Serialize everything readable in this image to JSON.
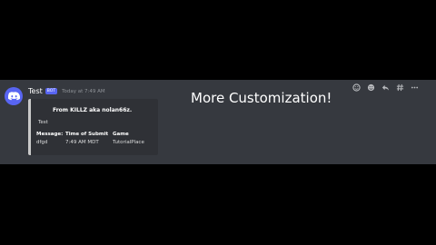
{
  "message": {
    "username": "Test",
    "bot_tag": "BOT",
    "timestamp": "Today at 7:49 AM"
  },
  "embed": {
    "author": "From KILLZ aka nolan66z.",
    "description": "Test",
    "fields": [
      {
        "name": "Message:",
        "value": "dfgd"
      },
      {
        "name": "Time of Submit",
        "value": "7:49 AM MDT"
      },
      {
        "name": "Game",
        "value": "TutorialPlace"
      }
    ],
    "accent_color": "#c9c9c9"
  },
  "overlay_title": "More Customization!",
  "toolbar_icons": [
    "add-reaction-icon",
    "emoji-icon",
    "reply-icon",
    "thread-icon",
    "more-icon"
  ],
  "colors": {
    "background": "#36393f",
    "embed_bg": "#2f3136",
    "brand": "#5865f2"
  }
}
